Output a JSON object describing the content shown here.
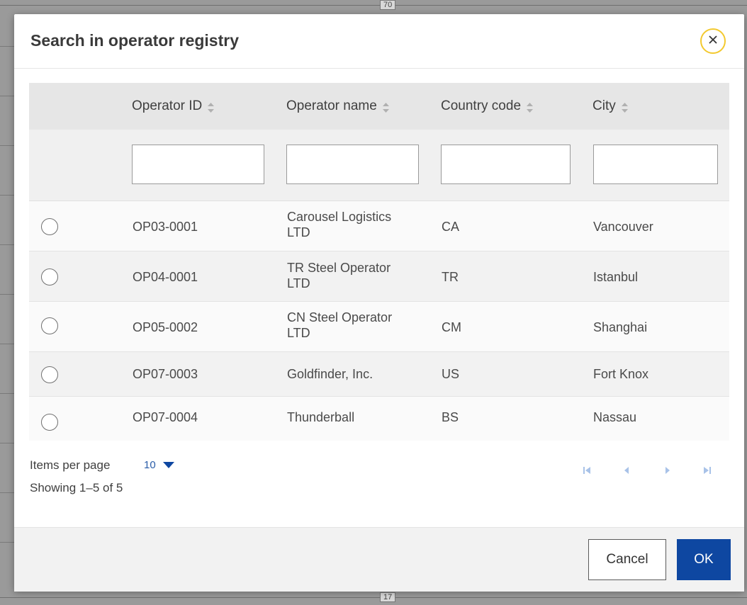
{
  "dialog": {
    "title": "Search in operator registry"
  },
  "background": {
    "top_tag": "70",
    "bottom_tag": "17"
  },
  "table": {
    "columns": [
      {
        "label": "Operator ID"
      },
      {
        "label": "Operator name"
      },
      {
        "label": "Country code"
      },
      {
        "label": "City"
      }
    ],
    "filters": {
      "operator_id": {
        "value": "",
        "placeholder": ""
      },
      "operator_name": {
        "value": "",
        "placeholder": ""
      },
      "country_code": {
        "value": "",
        "placeholder": ""
      },
      "city": {
        "value": "",
        "placeholder": ""
      }
    },
    "rows": [
      {
        "id": "OP03-0001",
        "name_line1": "Carousel Logistics",
        "name_line2": "LTD",
        "country": "CA",
        "city": "Vancouver",
        "selected": false
      },
      {
        "id": "OP04-0001",
        "name_line1": "TR Steel Operator",
        "name_line2": "LTD",
        "country": "TR",
        "city": "Istanbul",
        "selected": false
      },
      {
        "id": "OP05-0002",
        "name_line1": "CN Steel Operator",
        "name_line2": "LTD",
        "country": "CM",
        "city": "Shanghai",
        "selected": false
      },
      {
        "id": "OP07-0003",
        "name_line1": "Goldfinder, Inc.",
        "name_line2": "",
        "country": "US",
        "city": "Fort Knox",
        "selected": false
      },
      {
        "id": "OP07-0004",
        "name_line1": "Thunderball",
        "name_line2": "",
        "country": "BS",
        "city": "Nassau",
        "selected": false
      }
    ]
  },
  "pagination": {
    "items_per_page_label": "Items per page",
    "items_per_page_value": "10",
    "showing_text": "Showing 1–5 of 5"
  },
  "footer": {
    "cancel_label": "Cancel",
    "ok_label": "OK"
  },
  "colors": {
    "accent": "#0e47a1",
    "close_ring": "#f3c92f",
    "link_blue": "#2a5da8"
  },
  "icons": {
    "close": "close-icon",
    "sort": "sort-icon",
    "dropdown": "caret-down-icon",
    "first_page": "first-page-icon",
    "prev_page": "prev-page-icon",
    "next_page": "next-page-icon",
    "last_page": "last-page-icon"
  }
}
